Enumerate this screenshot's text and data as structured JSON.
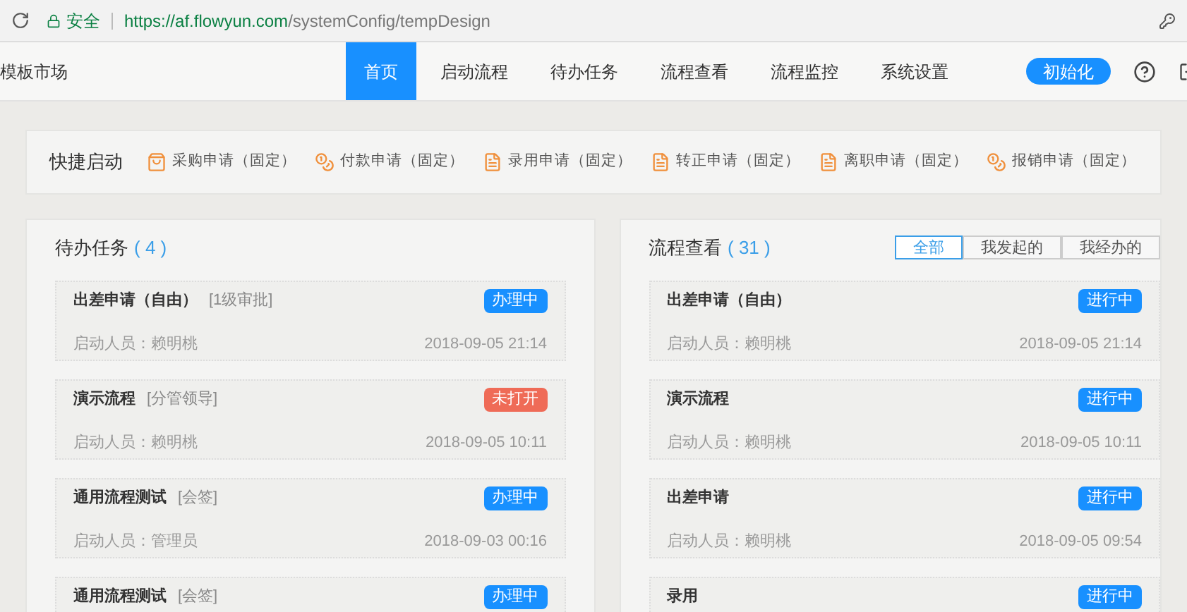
{
  "browser": {
    "secure_label": "安全",
    "url_origin": "https://af.flowyun.com",
    "url_path": "/systemConfig/tempDesign"
  },
  "nav": {
    "brand": "模板市场",
    "tabs": [
      {
        "label": "首页",
        "selected": true
      },
      {
        "label": "启动流程",
        "selected": false
      },
      {
        "label": "待办任务",
        "selected": false
      },
      {
        "label": "流程查看",
        "selected": false
      },
      {
        "label": "流程监控",
        "selected": false
      },
      {
        "label": "系统设置",
        "selected": false
      }
    ],
    "init_button": "初始化"
  },
  "quick_start": {
    "title": "快捷启动",
    "items": [
      {
        "label": "采购申请（固定）",
        "kind": "cart"
      },
      {
        "label": "付款申请（固定）",
        "kind": "coins"
      },
      {
        "label": "录用申请（固定）",
        "kind": "doc"
      },
      {
        "label": "转正申请（固定）",
        "kind": "doc"
      },
      {
        "label": "离职申请（固定）",
        "kind": "doc"
      },
      {
        "label": "报销申请（固定）",
        "kind": "coins"
      }
    ]
  },
  "todo": {
    "title": "待办任务",
    "count": "( 4 )",
    "items": [
      {
        "name": "出差申请（自由）",
        "step": "[1级审批]",
        "status": "办理中",
        "kind": "processing",
        "starter": "启动人员：赖明桃",
        "time": "2018-09-05 21:14"
      },
      {
        "name": "演示流程",
        "step": "[分管领导]",
        "status": "未打开",
        "kind": "unopened",
        "starter": "启动人员：赖明桃",
        "time": "2018-09-05 10:11"
      },
      {
        "name": "通用流程测试",
        "step": "[会签]",
        "status": "办理中",
        "kind": "processing",
        "starter": "启动人员：管理员",
        "time": "2018-09-03 00:16"
      },
      {
        "name": "通用流程测试",
        "step": "[会签]",
        "status": "办理中",
        "kind": "processing"
      }
    ]
  },
  "process": {
    "title": "流程查看",
    "count": "( 31 )",
    "filters": [
      {
        "label": "全部",
        "selected": true
      },
      {
        "label": "我发起的",
        "selected": false
      },
      {
        "label": "我经办的",
        "selected": false
      }
    ],
    "items": [
      {
        "name": "出差申请（自由）",
        "status": "进行中",
        "kind": "processing",
        "starter": "启动人员：赖明桃",
        "time": "2018-09-05 21:14"
      },
      {
        "name": "演示流程",
        "status": "进行中",
        "kind": "processing",
        "starter": "启动人员：赖明桃",
        "time": "2018-09-05 10:11"
      },
      {
        "name": "出差申请",
        "status": "进行中",
        "kind": "processing",
        "starter": "启动人员：赖明桃",
        "time": "2018-09-05 09:54"
      },
      {
        "name": "录用",
        "status": "进行中",
        "kind": "processing"
      }
    ]
  }
}
